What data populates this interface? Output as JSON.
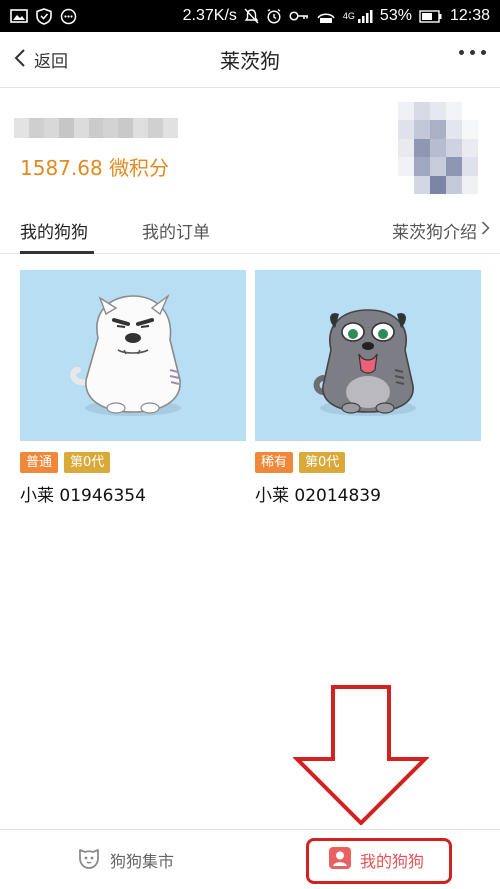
{
  "status_bar": {
    "speed": "2.37K/s",
    "network": "4G",
    "battery": "53%",
    "time": "12:38"
  },
  "nav": {
    "back_label": "返回",
    "title": "莱茨狗"
  },
  "account": {
    "points": "1587.68 微积分"
  },
  "tabs": {
    "my_dogs": "我的狗狗",
    "my_orders": "我的订单",
    "intro": "莱茨狗介绍"
  },
  "dogs": [
    {
      "tags": [
        "普通",
        "第0代"
      ],
      "name": "小莱 01946354"
    },
    {
      "tags": [
        "稀有",
        "第0代"
      ],
      "name": "小莱 02014839"
    }
  ],
  "bottom_nav": {
    "market": "狗狗集市",
    "my_dogs": "我的狗狗"
  },
  "colors": {
    "accent_orange": "#e08a22",
    "tag_common": "#f0883a",
    "tag_rare": "#f0883a",
    "tag_generation": "#d9a93a",
    "card_background": "#b8def4",
    "annotation_red": "#d22121"
  }
}
